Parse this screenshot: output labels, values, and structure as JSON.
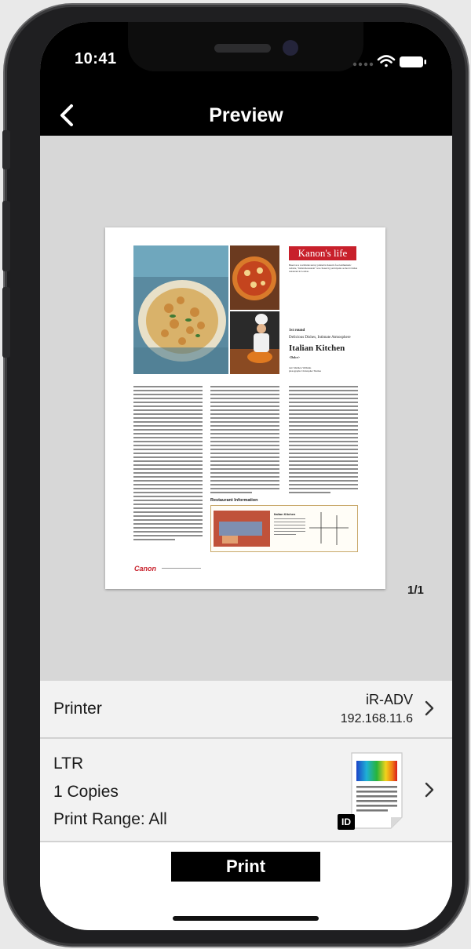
{
  "status_bar": {
    "time": "10:41"
  },
  "nav": {
    "title": "Preview",
    "back_icon": "chevron-left-icon"
  },
  "preview": {
    "page_indicator": "1/1",
    "document": {
      "brand_badge": "Kanon's life",
      "intro_text": "Based on a worldwide survey printed in Kanon's food enthusiastic website, \"Italian Restaurant\" was chosen by participants as the #1 Italian restaurant in London.",
      "round_label": "1st round",
      "tagline": "Delicious Dishes, Intimate Atmosphere",
      "headline": "Italian Kitchen",
      "subhead": "<Dolce>",
      "credits": "text: Matthew Williams\nphotographs: Christopher Thomas",
      "section_heading": "Restaurant Information",
      "restaurant_name": "Italian Kitchen",
      "footer_logo": "Canon"
    }
  },
  "printer": {
    "label": "Printer",
    "name": "iR-ADV",
    "ip": "192.168.11.6"
  },
  "settings": {
    "paper_size": "LTR",
    "copies": "1 Copies",
    "print_range": "Print Range: All",
    "badge": "ID"
  },
  "actions": {
    "print_label": "Print"
  }
}
